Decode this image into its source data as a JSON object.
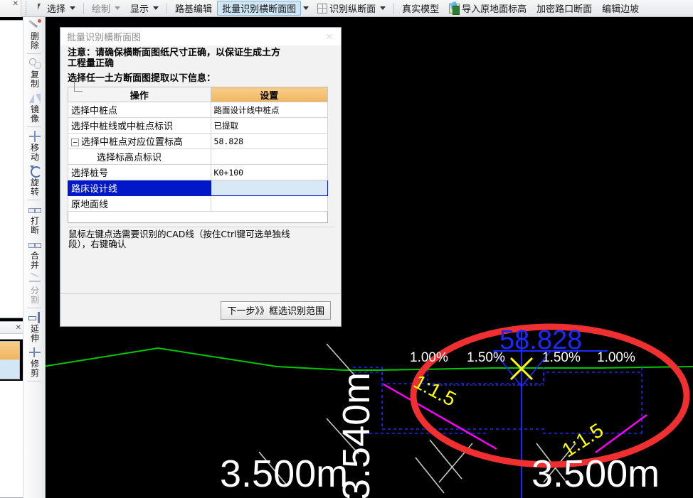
{
  "toolbar": {
    "items": [
      {
        "label": "选择",
        "icon": "cursor-icon",
        "caret": true,
        "state": "normal"
      },
      {
        "label": "绘制",
        "icon": "",
        "caret": true,
        "state": "dim"
      },
      {
        "label": "显示",
        "icon": "",
        "caret": true,
        "state": "normal"
      },
      {
        "label": "路基编辑",
        "icon": "",
        "caret": false,
        "state": "normal"
      },
      {
        "label": "批量识别横断面图",
        "icon": "",
        "caret": true,
        "state": "active"
      },
      {
        "label": "识别纵断面",
        "icon": "grid-icon",
        "caret": true,
        "state": "normal"
      },
      {
        "label": "真实模型",
        "icon": "",
        "caret": false,
        "state": "normal"
      },
      {
        "label": "导入原地面标高",
        "icon": "excel-import-icon",
        "caret": false,
        "state": "normal"
      },
      {
        "label": "加密路口断面",
        "icon": "",
        "caret": false,
        "state": "normal"
      },
      {
        "label": "编辑边坡",
        "icon": "",
        "caret": false,
        "state": "normal"
      }
    ]
  },
  "left_toolstrip": {
    "items": [
      {
        "label": "删除",
        "icon": "eraser-icon",
        "state": "normal"
      },
      {
        "label": "复制",
        "icon": "copy-icon",
        "state": "normal"
      },
      {
        "label": "镜像",
        "icon": "mirror-icon",
        "state": "normal"
      },
      {
        "label": "移动",
        "icon": "move-icon",
        "state": "normal"
      },
      {
        "label": "旋转",
        "icon": "rotate-icon",
        "state": "normal"
      },
      {
        "label": "打断",
        "icon": "break-icon",
        "state": "normal"
      },
      {
        "label": "合并",
        "icon": "merge-icon",
        "state": "normal"
      },
      {
        "label": "分割",
        "icon": "split-icon",
        "state": "dim"
      },
      {
        "label": "延伸",
        "icon": "extend-icon",
        "state": "normal"
      },
      {
        "label": "修剪",
        "icon": "trim-icon",
        "state": "normal"
      }
    ]
  },
  "side_panels": {
    "close_glyph": "✕"
  },
  "dialog": {
    "title": "批量识别横断面图",
    "close_label": "✕",
    "note_line1": "注意：请确保横断面图纸尺寸正确，以保证生成土方",
    "note_line2": "工程量正确",
    "subtitle": "选择任一土方断面图提取以下信息：",
    "table": {
      "headers": [
        "操作",
        "设置"
      ],
      "rows": [
        {
          "operation": "选择中桩点",
          "setting": "路面设计线中桩点",
          "indent": "normal",
          "tree": "none",
          "selected": false
        },
        {
          "operation": "选择中桩线或中桩点标识",
          "setting": "已提取",
          "indent": "normal",
          "tree": "none",
          "selected": false
        },
        {
          "operation": "选择中桩点对应位置标高",
          "setting": "58.828",
          "indent": "tree",
          "tree": "minus",
          "selected": false
        },
        {
          "operation": "选择标高点标识",
          "setting": "",
          "indent": "child",
          "tree": "elbow",
          "selected": false
        },
        {
          "operation": "选择桩号",
          "setting": "K0+100",
          "indent": "normal",
          "tree": "none",
          "selected": false
        },
        {
          "operation": "路床设计线",
          "setting": "",
          "indent": "normal",
          "tree": "none",
          "selected": true
        },
        {
          "operation": "原地面线",
          "setting": "",
          "indent": "normal",
          "tree": "none",
          "selected": false
        }
      ]
    },
    "hint_line1": "鼠标左键点选需要识别的CAD线（按住Ctrl键可选单独线",
    "hint_line2": "段），右键确认",
    "next_button": "下一步》》框选识别范围"
  },
  "canvas": {
    "elevation_label": "58.828",
    "grade_labels": [
      "1.00%",
      "1.50%",
      "1.50%",
      "1.00%"
    ],
    "slope_labels": [
      "1:1.5",
      "1:1.5"
    ],
    "dimension_left": "3.500m",
    "dimension_right": "3.500m",
    "dimension_vertical": "3.540m",
    "colors": {
      "ground_line": "#00c800",
      "design_line": "#0018ff",
      "slope_line": "#ff00ff",
      "center_marker": "#ffff00",
      "annotation_ellipse": "#f03030",
      "background": "#000000"
    }
  }
}
